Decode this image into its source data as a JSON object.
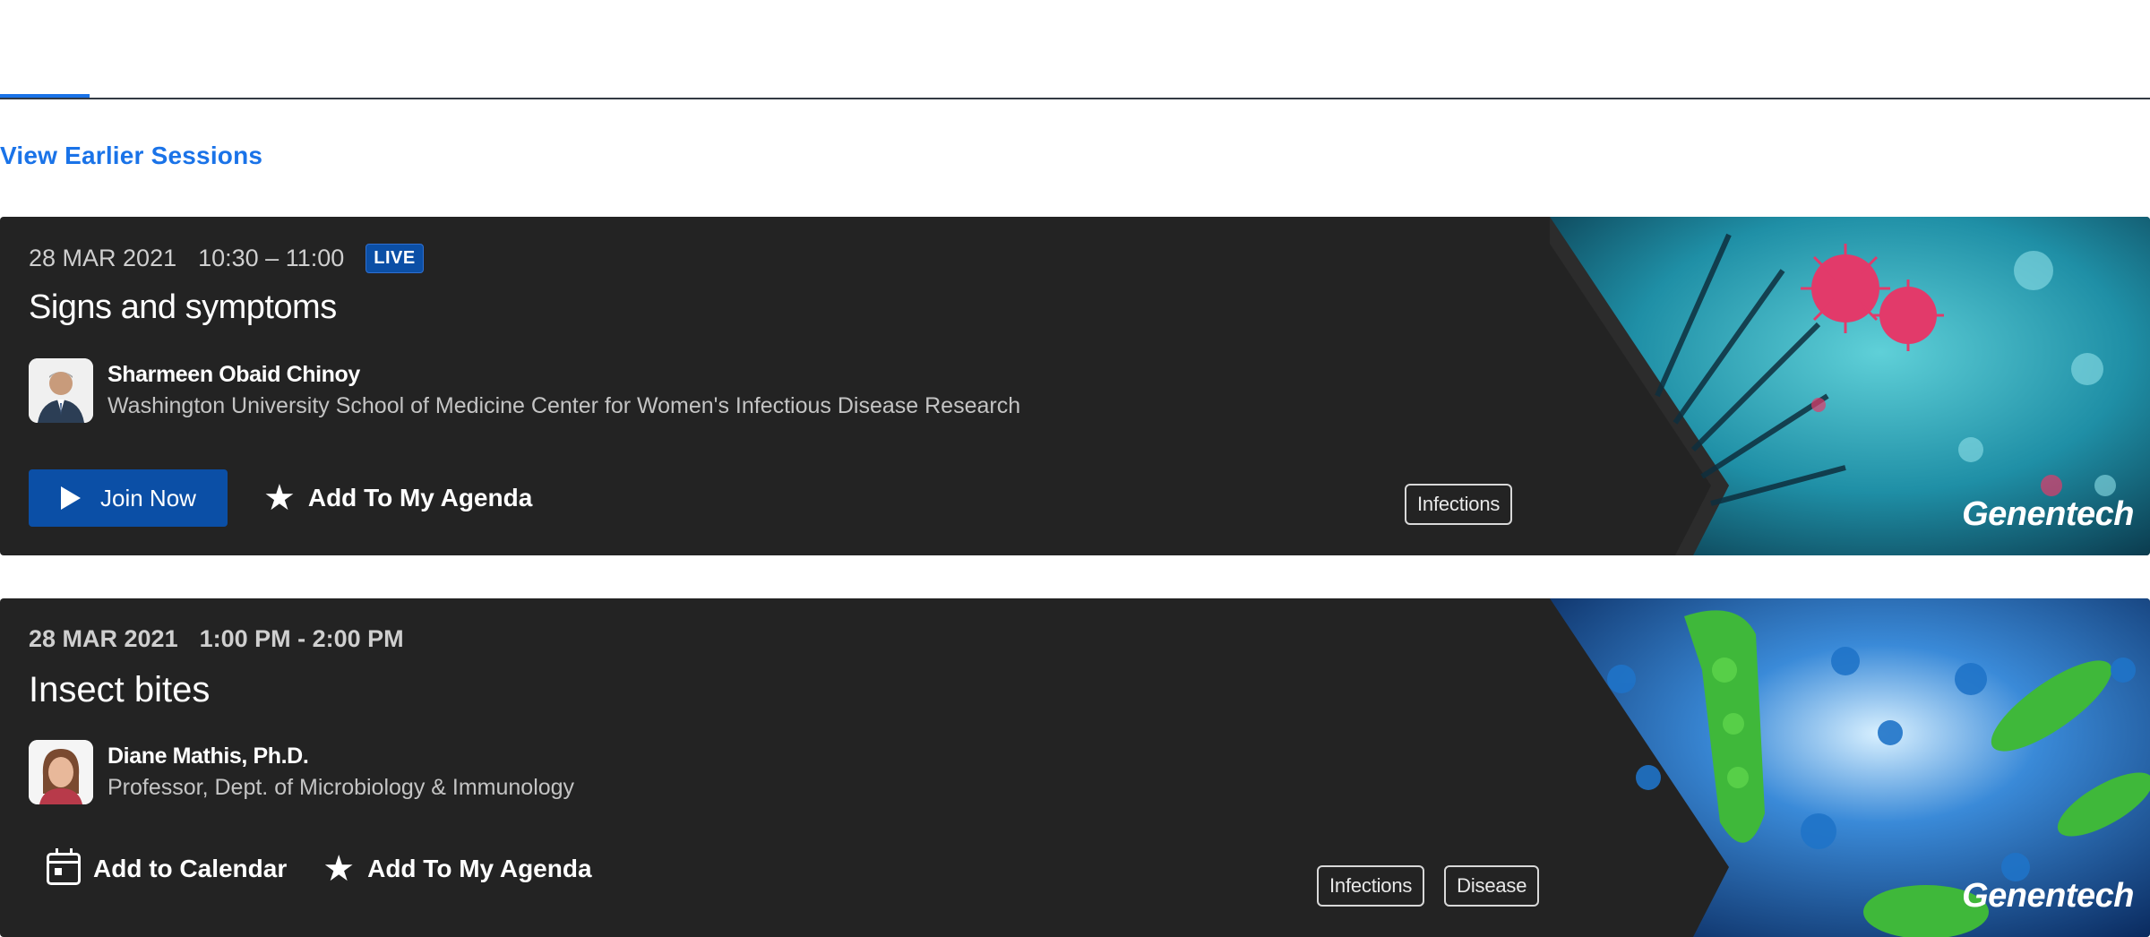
{
  "nav": {
    "view_earlier_label": "View Earlier Sessions"
  },
  "sessions": [
    {
      "date": "28 MAR 2021",
      "time": "10:30 – 11:00",
      "live_badge": "LIVE",
      "title": "Signs and symptoms",
      "speaker": {
        "name": "Sharmeen Obaid Chinoy",
        "org": "Washington University School of Medicine Center for Women's Infectious Disease Research"
      },
      "join_label": "Join Now",
      "agenda_label": "Add To My Agenda",
      "tags": [
        "Infections"
      ],
      "sponsor": "Genentech"
    },
    {
      "date": "28 MAR 2021",
      "time": "1:00 PM - 2:00 PM",
      "title": "Insect bites",
      "speaker": {
        "name": "Diane Mathis, Ph.D.",
        "org": "Professor, Dept. of Microbiology & Immunology"
      },
      "calendar_label": "Add to Calendar",
      "agenda_label": "Add To My Agenda",
      "tags": [
        "Infections",
        "Disease"
      ],
      "sponsor": "Genentech"
    }
  ],
  "colors": {
    "accent": "#1a73e8",
    "card_bg": "#232323",
    "button_bg": "#0b4fa6"
  },
  "icons": {
    "play": "play-icon",
    "star": "star-icon",
    "calendar": "calendar-icon"
  }
}
